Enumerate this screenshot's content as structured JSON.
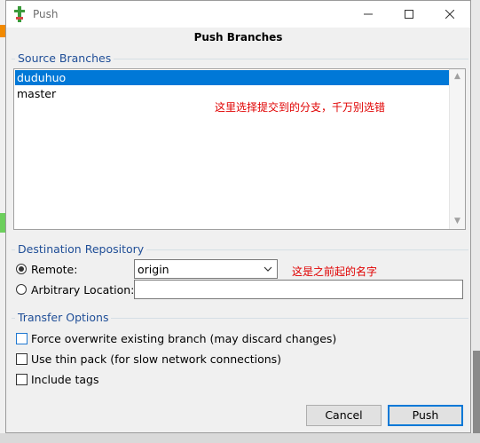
{
  "window": {
    "title": "Push"
  },
  "dialog": {
    "title": "Push Branches"
  },
  "source": {
    "legend": "Source Branches",
    "branches": [
      {
        "name": "duduhuo",
        "selected": true
      },
      {
        "name": "master",
        "selected": false
      }
    ],
    "annotation": "这里选择提交到的分支，千万别选错"
  },
  "destination": {
    "legend": "Destination Repository",
    "remote_label": "Remote:",
    "remote_value": "origin",
    "remote_selected": true,
    "arbitrary_label": "Arbitrary Location:",
    "arbitrary_value": "",
    "annotation": "这是之前起的名字"
  },
  "transfer": {
    "legend": "Transfer Options",
    "options": [
      {
        "label": "Force overwrite existing branch (may discard changes)",
        "checked": false
      },
      {
        "label": "Use thin pack (for slow network connections)",
        "checked": false
      },
      {
        "label": "Include tags",
        "checked": false
      }
    ]
  },
  "buttons": {
    "cancel": "Cancel",
    "push": "Push"
  },
  "colors": {
    "selection": "#0078d7",
    "legend": "#1f4e97",
    "annotation": "#e00000"
  }
}
